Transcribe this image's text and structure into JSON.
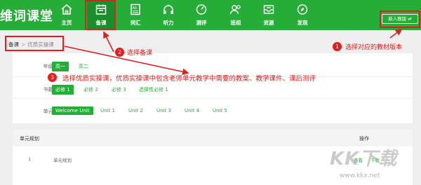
{
  "logo": "维词课堂",
  "nav": [
    {
      "label": "主页",
      "icon": "home-icon"
    },
    {
      "label": "备课",
      "icon": "calendar-icon"
    },
    {
      "label": "词汇",
      "icon": "vocab-book-icon"
    },
    {
      "label": "听力",
      "icon": "headphones-icon"
    },
    {
      "label": "测评",
      "icon": "gauge-icon"
    },
    {
      "label": "班组",
      "icon": "group-icon"
    },
    {
      "label": "资源",
      "icon": "inbox-icon"
    },
    {
      "label": "发现",
      "icon": "compass-icon"
    }
  ],
  "edition_button": "新人教版 ⇄",
  "breadcrumb": {
    "home": "备课",
    "sep": ">",
    "current": "优质实操课"
  },
  "filters": {
    "grade": {
      "label": "年级:",
      "options": [
        "高一",
        "高二"
      ],
      "selected": "高一"
    },
    "book": {
      "label": "书籍:",
      "options": [
        "必修 1",
        "必修 2",
        "必修 3",
        "选择性必修 1"
      ],
      "selected": "必修 1"
    },
    "unit": {
      "label": "单元:",
      "options": [
        "Welcome Unit",
        "Unit 1",
        "Unit 2",
        "Unit 3",
        "Unit 4",
        "Unit 5"
      ],
      "selected": "Welcome Unit"
    }
  },
  "table": {
    "headers": {
      "title": "单元规划",
      "action": "操作"
    },
    "rows": [
      {
        "index": "1",
        "name": "单元规划",
        "action_view": "查看",
        "action_download": "下载"
      }
    ]
  },
  "annotations": [
    {
      "num": "1",
      "text": "选择对应的教材版本"
    },
    {
      "num": "2",
      "text": "选择备课"
    },
    {
      "num": "3",
      "text": "选择优质实操课，优质实操课中包含老师单元教学中需要的教案、教学课件、课后测评"
    }
  ],
  "watermark": {
    "text": "KK下载",
    "url": "www.kkx.net"
  },
  "colors": {
    "brand_green": "#26ad38",
    "annotation_red": "#e02020"
  }
}
